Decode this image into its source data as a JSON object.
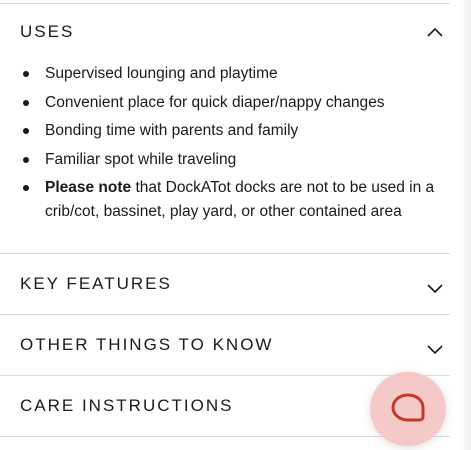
{
  "sections": {
    "uses": {
      "title": "USES",
      "expanded": true,
      "items": [
        {
          "bold": "",
          "text": "Supervised lounging and playtime"
        },
        {
          "bold": "",
          "text": "Convenient place for quick diaper/nappy changes"
        },
        {
          "bold": "",
          "text": "Bonding time with parents and family"
        },
        {
          "bold": "",
          "text": "Familiar spot while traveling"
        },
        {
          "bold": "Please note",
          "text": " that DockATot docks are not to be used in a crib/cot, bassinet, play yard, or other contained area"
        }
      ]
    },
    "key_features": {
      "title": "KEY FEATURES",
      "expanded": false
    },
    "other_things": {
      "title": "OTHER THINGS TO KNOW",
      "expanded": false
    },
    "care": {
      "title": "CARE INSTRUCTIONS",
      "expanded": false
    }
  },
  "icons": {
    "expanded": "chevron-up-icon",
    "collapsed": "chevron-down-icon",
    "chat": "chat-bubble-icon"
  },
  "colors": {
    "chat_button": "#f6c9c9",
    "chat_icon": "#c0392b",
    "divider": "#dcdcdc",
    "text": "#1a1a1a"
  }
}
